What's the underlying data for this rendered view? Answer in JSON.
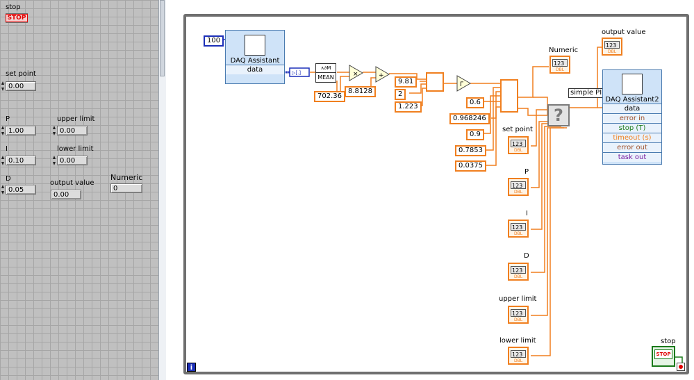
{
  "front_panel": {
    "stop": {
      "label": "stop",
      "button_text": "STOP"
    },
    "set_point": {
      "label": "set point",
      "value": "0.00"
    },
    "p": {
      "label": "P",
      "value": "1.00"
    },
    "i": {
      "label": "I",
      "value": "0.10"
    },
    "d": {
      "label": "D",
      "value": "0.05"
    },
    "upper_limit": {
      "label": "upper limit",
      "value": "0.00"
    },
    "lower_limit": {
      "label": "lower limit",
      "value": "0.00"
    },
    "output_value": {
      "label": "output value",
      "value": "0.00"
    },
    "numeric": {
      "label": "Numeric",
      "value": "0"
    }
  },
  "diagram": {
    "samples_const": "100",
    "daq1": {
      "title": "DAQ Assistant",
      "port": "data"
    },
    "mean_label": "MEAN",
    "const_70236": "702.36",
    "const_88128": "8.8128",
    "const_981": "9.81",
    "const_2": "2",
    "const_1223": "1.223",
    "const_06": "0.6",
    "const_0968246": "0.968246",
    "const_09": "0.9",
    "const_07853": "0.7853",
    "const_00375": "0.0375",
    "numeric_label": "Numeric",
    "pid_label": "simple PID.vi",
    "output_value_label": "output value",
    "term_text": "123",
    "term_sub": "DBL",
    "set_point_label": "set point",
    "p_label": "P",
    "i_label": "I",
    "d_label": "D",
    "upper_limit_label": "upper limit",
    "lower_limit_label": "lower limit",
    "daq2": {
      "title": "DAQ Assistant2",
      "ports": [
        "data",
        "error in",
        "stop (T)",
        "timeout (s)",
        "error out",
        "task out"
      ]
    },
    "stop_label": "stop",
    "stop_term_text": "STOP",
    "info_icon": "i",
    "colors": {
      "orange": "#f07f1f",
      "blue": "#1c2fb8",
      "green": "#1a7a1a",
      "red": "#e00000"
    }
  }
}
